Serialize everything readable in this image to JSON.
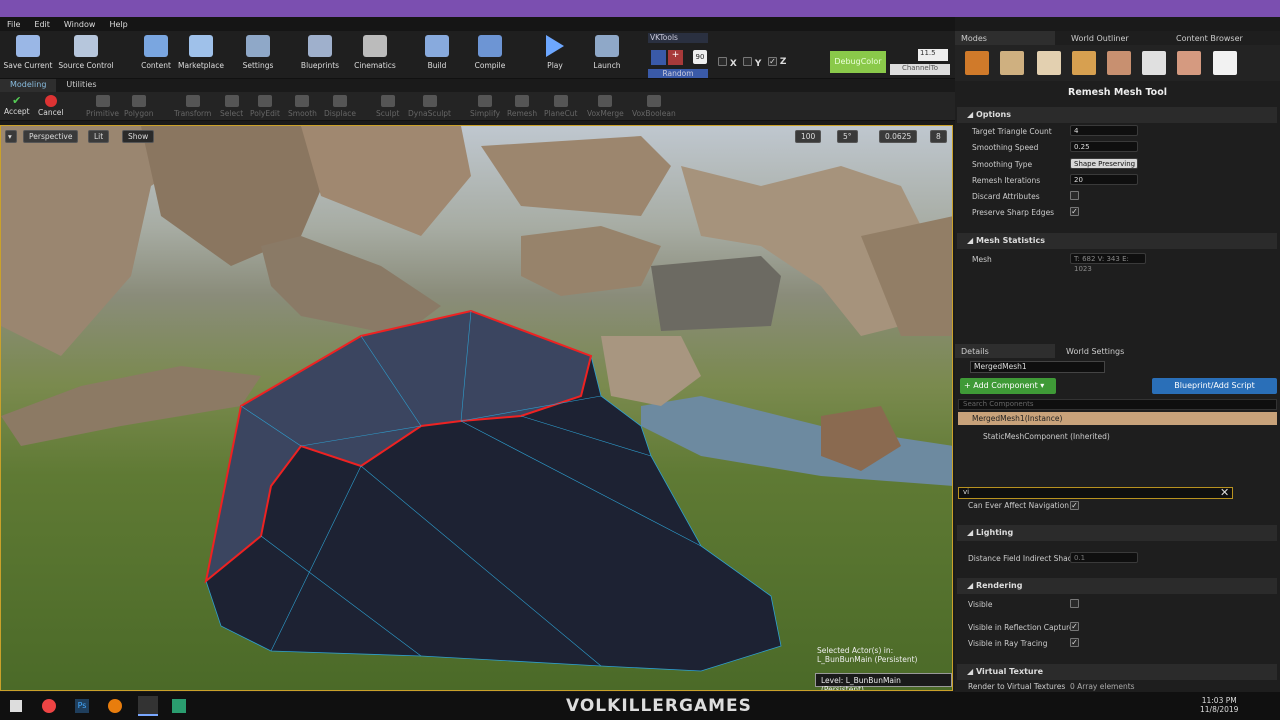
{
  "menu": [
    "File",
    "Edit",
    "Window",
    "Help"
  ],
  "toolbar": {
    "buttons": [
      {
        "label": "Save Current",
        "color": "#9ab7e6"
      },
      {
        "label": "Source Control",
        "color": "#b6c6dc"
      },
      {
        "label": "Content",
        "color": "#7aa6e0"
      },
      {
        "label": "Marketplace",
        "color": "#9fc1ea"
      },
      {
        "label": "Settings",
        "color": "#8fa8c8"
      },
      {
        "label": "Blueprints",
        "color": "#9fb0cc"
      },
      {
        "label": "Cinematics",
        "color": "#bbbbbb"
      },
      {
        "label": "Build",
        "color": "#88aadd"
      },
      {
        "label": "Compile",
        "color": "#6d95d4"
      },
      {
        "label": "Play",
        "color": "#6da7ff"
      },
      {
        "label": "Launch",
        "color": "#8fa8c8"
      }
    ]
  },
  "vktools": {
    "title": "VKTools",
    "value": "90",
    "x": "X",
    "y": "Y",
    "z": "Z",
    "random": "Random",
    "debug": "DebugColor",
    "channel": "ChannelTo",
    "num": "11.5"
  },
  "mode_tabs": [
    "Modeling",
    "Utilities"
  ],
  "modeling": {
    "accept": "Accept",
    "cancel": "Cancel",
    "tools": [
      "Primitive",
      "Polygon",
      "Transform",
      "Select",
      "PolyEdit",
      "Smooth",
      "Displace",
      "Sculpt",
      "DynaSculpt",
      "Simplify",
      "Remesh",
      "PlaneCut",
      "VoxMerge",
      "VoxBoolean"
    ]
  },
  "viewport": {
    "perspective": "Perspective",
    "lit": "Lit",
    "show": "Show",
    "grid": "100",
    "angle": "5°",
    "scale": "0.0625",
    "speed": "8",
    "selected": "Selected Actor(s) in:",
    "selected_level": "L_BunBunMain (Persistent)",
    "level": "Level:  L_BunBunMain (Persistent)"
  },
  "panel_tabs": {
    "modes": "Modes",
    "outliner": "World Outliner",
    "content": "Content Browser"
  },
  "remesh": {
    "title": "Remesh Mesh Tool",
    "options": "Options",
    "target_triangle": {
      "label": "Target Triangle Count",
      "value": "4"
    },
    "smoothing_speed": {
      "label": "Smoothing Speed",
      "value": "0.25"
    },
    "smoothing_type": {
      "label": "Smoothing Type",
      "value": "Shape Preserving"
    },
    "remesh_iterations": {
      "label": "Remesh Iterations",
      "value": "20"
    },
    "discard": {
      "label": "Discard Attributes"
    },
    "sharp": {
      "label": "Preserve Sharp Edges"
    },
    "mesh_stats": "Mesh Statistics",
    "mesh": {
      "label": "Mesh",
      "value": "T: 682  V: 343  E: 1023"
    }
  },
  "details": {
    "tab_details": "Details",
    "tab_world": "World Settings",
    "actor_name": "MergedMesh1",
    "add_component": "+ Add Component ▾",
    "blueprint": "Blueprint/Add Script",
    "search_placeholder": "Search Components",
    "root": "MergedMesh1(Instance)",
    "component": "StaticMeshComponent (Inherited)",
    "filter": "vi",
    "can_ever": "Can Ever Affect Navigation",
    "lighting": "Lighting",
    "dist_field": "Distance Field Indirect Shadow",
    "dist_val": "0.1",
    "rendering": "Rendering",
    "visible": "Visible",
    "vis_reflect": "Visible in Reflection Captures",
    "vis_ray": "Visible in Ray Tracing",
    "virtual_texture": "Virtual Texture",
    "render_vt": "Render to Virtual Textures",
    "render_vt_val": "0 Array elements"
  },
  "taskbar": {
    "brand": "VOLKILLERGAMES",
    "time": "11:03 PM",
    "date": "11/8/2019"
  }
}
